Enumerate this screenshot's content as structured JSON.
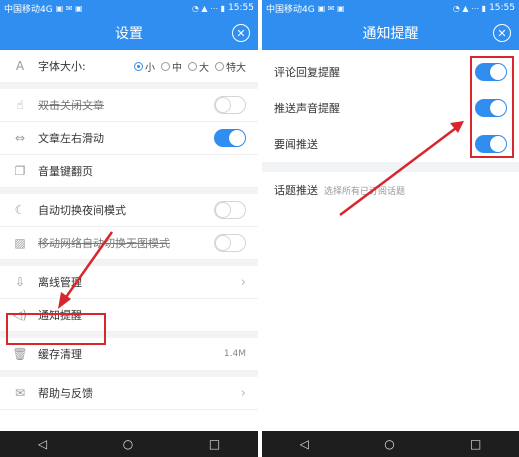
{
  "left": {
    "status": {
      "carrier": "中国移动4G",
      "time": "15:55"
    },
    "title": "设置",
    "font_size": {
      "label": "字体大小:",
      "options": [
        "小",
        "中",
        "大",
        "特大"
      ],
      "selected": "小"
    },
    "items": [
      {
        "label": "双击关闭文章",
        "toggle": "off",
        "icon": "hand-icon"
      },
      {
        "label": "文章左右滑动",
        "toggle": "on",
        "icon": "swap-icon"
      },
      {
        "label": "音量键翻页",
        "toggle": "none",
        "icon": "pages-icon"
      },
      {
        "label": "自动切换夜间模式",
        "toggle": "off",
        "icon": "moon-icon"
      },
      {
        "label": "移动网络自动切换无图模式",
        "toggle": "off",
        "icon": "image-icon"
      },
      {
        "label": "离线管理",
        "icon": "download-icon"
      },
      {
        "label": "通知提醒",
        "icon": "speaker-icon"
      },
      {
        "label": "缓存清理",
        "value": "1.4M",
        "icon": "trash-icon"
      },
      {
        "label": "帮助与反馈",
        "icon": "mail-icon"
      }
    ]
  },
  "right": {
    "status": {
      "carrier": "中国移动4G",
      "time": "15:55"
    },
    "title": "通知提醒",
    "items": [
      {
        "label": "评论回复提醒",
        "toggle": "on"
      },
      {
        "label": "推送声音提醒",
        "toggle": "on"
      },
      {
        "label": "要闻推送",
        "toggle": "on"
      },
      {
        "label": "话题推送",
        "hint": "选择所有已订阅话题"
      }
    ]
  },
  "nav": {
    "back": "◁",
    "home": "○",
    "recent": "□"
  },
  "colors": {
    "accent": "#2f8ef0",
    "highlight": "#d8262c"
  }
}
